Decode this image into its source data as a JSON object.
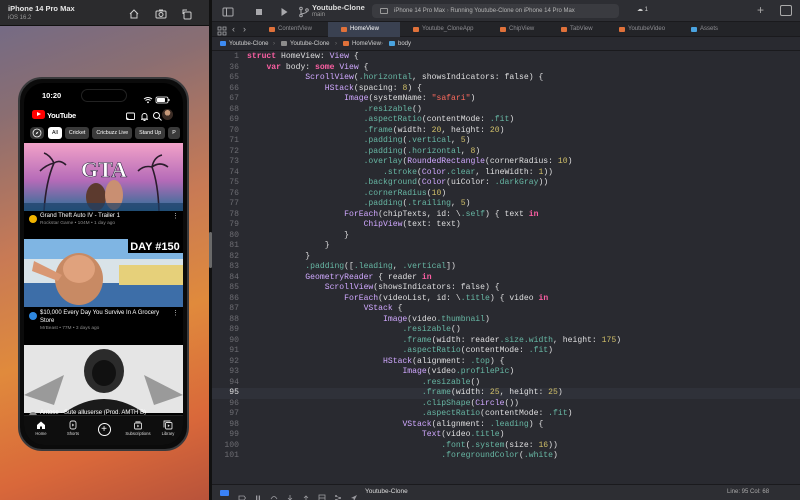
{
  "simulator": {
    "device": "iPhone 14 Pro Max",
    "os": "iOS 16.2",
    "status_time": "10:20"
  },
  "youtube": {
    "brand": "YouTube",
    "chips": [
      "All",
      "Cricket",
      "Cricbuzz Live",
      "Stand Up",
      "P"
    ],
    "videos": [
      {
        "title": "Grand Theft Auto IV - Trailer 1",
        "meta": "Rockstar Game • 104M • 1 day ago",
        "thumb_text": "GTA",
        "thumb_colors": [
          "#f0a0c8",
          "#b06ab6",
          "#2a7a9c"
        ],
        "avatar_color": "#f1b400"
      },
      {
        "title": "$10,000 Every Day You Survive In A Grocery Store",
        "meta": "MrBeast • 77M • 3 days ago",
        "thumb_text": "DAY #150",
        "thumb_colors": [
          "#7fb8e8",
          "#d8e4ea",
          "#3d6ea8"
        ],
        "avatar_color": "#2f88e0"
      },
      {
        "title": "Antose - Sute alluserse (Prod. AMTH B)",
        "meta": "",
        "thumb_text": "",
        "thumb_colors": [
          "#e9e9e9",
          "#8f8f8f",
          "#1a1a1a"
        ],
        "avatar_color": "#888888"
      }
    ],
    "tabs": [
      "Home",
      "Shorts",
      "",
      "Subscriptions",
      "Library"
    ]
  },
  "xcode": {
    "project": "Youtube-Clone",
    "branch": "main",
    "run_device": "iPhone 14 Pro Max",
    "run_status": "Running Youtube-Clone on iPhone 14 Pro Max",
    "cloud_count": "1",
    "file_tabs": [
      "ContentView",
      "HomeView",
      "Youtube_CloneApp",
      "ChipView",
      "TabView",
      "YoutubeVideo",
      "Assets"
    ],
    "active_tab": "HomeView",
    "breadcrumbs": [
      "Youtube-Clone",
      "Youtube-Clone",
      "HomeView",
      "body"
    ],
    "current_line": "95",
    "code_lines": [
      {
        "n": "1",
        "t": "struct HomeView: View {"
      },
      {
        "n": "36",
        "t": "    var body: some View {"
      },
      {
        "n": "65",
        "t": "            ScrollView(.horizontal, showsIndicators: false) {"
      },
      {
        "n": "66",
        "t": "                HStack(spacing: 8) {"
      },
      {
        "n": "67",
        "t": "                    Image(systemName: \"safari\")"
      },
      {
        "n": "68",
        "t": "                        .resizable()"
      },
      {
        "n": "69",
        "t": "                        .aspectRatio(contentMode: .fit)"
      },
      {
        "n": "70",
        "t": "                        .frame(width: 20, height: 20)"
      },
      {
        "n": "71",
        "t": "                        .padding(.vertical, 5)"
      },
      {
        "n": "72",
        "t": "                        .padding(.horizontal, 8)"
      },
      {
        "n": "73",
        "t": "                        .overlay(RoundedRectangle(cornerRadius: 10)"
      },
      {
        "n": "74",
        "t": "                            .stroke(Color.clear, lineWidth: 1))"
      },
      {
        "n": "75",
        "t": "                        .background(Color(uiColor: .darkGray))"
      },
      {
        "n": "76",
        "t": "                        .cornerRadius(10)"
      },
      {
        "n": "77",
        "t": "                        .padding(.trailing, 5)"
      },
      {
        "n": "78",
        "t": "                    ForEach(chipTexts, id: \\.self) { text in"
      },
      {
        "n": "79",
        "t": "                        ChipView(text: text)"
      },
      {
        "n": "80",
        "t": "                    }"
      },
      {
        "n": "81",
        "t": "                }"
      },
      {
        "n": "82",
        "t": "            }"
      },
      {
        "n": "83",
        "t": "            .padding([.leading, .vertical])"
      },
      {
        "n": "84",
        "t": "            GeometryReader { reader in"
      },
      {
        "n": "85",
        "t": "                ScrollView(showsIndicators: false) {"
      },
      {
        "n": "86",
        "t": "                    ForEach(videoList, id: \\.title) { video in"
      },
      {
        "n": "87",
        "t": "                        VStack {"
      },
      {
        "n": "88",
        "t": "                            Image(video.thumbnail)"
      },
      {
        "n": "89",
        "t": "                                .resizable()"
      },
      {
        "n": "90",
        "t": "                                .frame(width: reader.size.width, height: 175)"
      },
      {
        "n": "91",
        "t": "                                .aspectRatio(contentMode: .fit)"
      },
      {
        "n": "92",
        "t": "                            HStack(alignment: .top) {"
      },
      {
        "n": "93",
        "t": "                                Image(video.profilePic)"
      },
      {
        "n": "94",
        "t": "                                    .resizable()"
      },
      {
        "n": "95",
        "t": "                                    .frame(width: 25, height: 25)"
      },
      {
        "n": "96",
        "t": "                                    .clipShape(Circle())"
      },
      {
        "n": "97",
        "t": "                                    .aspectRatio(contentMode: .fit)"
      },
      {
        "n": "98",
        "t": "                                VStack(alignment: .leading) {"
      },
      {
        "n": "99",
        "t": "                                    Text(video.title)"
      },
      {
        "n": "100",
        "t": "                                        .font(.system(size: 16))"
      },
      {
        "n": "101",
        "t": "                                        .foregroundColor(.white)"
      }
    ],
    "status_target": "Youtube-Clone",
    "cursor_position": "Line: 95  Col: 68"
  }
}
